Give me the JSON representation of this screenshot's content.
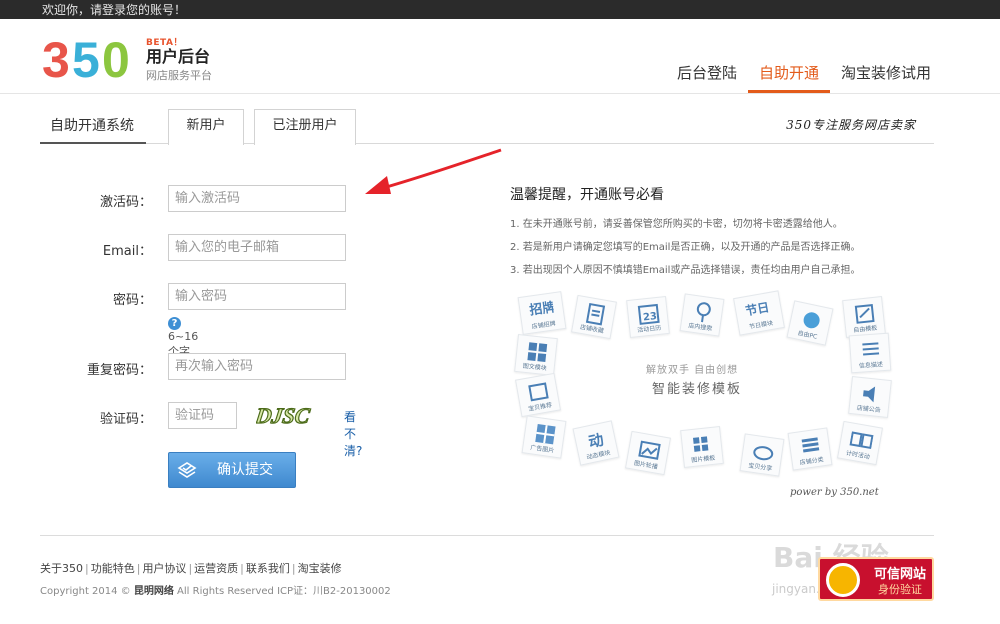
{
  "topbar": {
    "welcome": "欢迎你，请登录您的账号！"
  },
  "header": {
    "logo_text": "350",
    "beta": "BETA！",
    "title": "用户后台",
    "subtitle": "网店服务平台",
    "nav": [
      {
        "label": "后台登陆",
        "active": false
      },
      {
        "label": "自助开通",
        "active": true
      },
      {
        "label": "淘宝装修试用",
        "active": false
      }
    ]
  },
  "tabs": {
    "system_label": "自助开通系统",
    "new_user": "新用户",
    "registered_user": "已注册用户",
    "slogan": "350专注服务网店卖家"
  },
  "form": {
    "activation": {
      "label": "激活码：",
      "placeholder": "输入激活码"
    },
    "email": {
      "label": "Email：",
      "placeholder": "输入您的电子邮箱"
    },
    "password": {
      "label": "密码：",
      "placeholder": "输入密码",
      "hint": "6~16个字符"
    },
    "confirm": {
      "label": "重复密码：",
      "placeholder": "再次输入密码"
    },
    "captcha": {
      "label": "验证码：",
      "placeholder": "验证码",
      "image_text": "DJSC",
      "refresh": "看不清?"
    },
    "submit": "确认提交"
  },
  "tips": {
    "title": "温馨提醒，开通账号必看",
    "items": [
      "1. 在未开通账号前，请妥善保管您所购买的卡密，切勿将卡密透露给他人。",
      "2. 若是新用户请确定您填写的Email是否正确，以及开通的产品是否选择正确。",
      "3. 若出现因个人原因不慎填错Email或产品选择错误，责任均由用户自己承担。"
    ]
  },
  "mosaic": {
    "line1": "解放双手  自由创想",
    "line2": "智能装修模板",
    "powered": "power by 350.net",
    "tiles": [
      "招牌",
      "店铺招牌",
      "店铺收藏",
      "23",
      "活动日历",
      "店内搜索",
      "节日",
      "节日模块",
      "自由PC",
      "自由模板",
      "图文模块",
      "信息描述",
      "店铺公告",
      "宝贝推荐",
      "广告图片",
      "动",
      "动态模块",
      "图片轮播",
      "图片模板",
      "宝贝分享",
      "店铺分类",
      "计时活动",
      "活动模板"
    ]
  },
  "footer": {
    "links": [
      "关于350",
      "功能特色",
      "用户协议",
      "运营资质",
      "联系我们",
      "淘宝装修"
    ],
    "copyright": "Copyright 2014 ©",
    "company": "昆明网络",
    "rights": "All Rights Reserved ICP证：川B2-20130002"
  },
  "watermark": {
    "text": "Bai 经验",
    "url": "jingyan.baidu.com",
    "badge_line1": "可信网站",
    "badge_line2": "身份验证"
  },
  "colors": {
    "accent": "#e35b1b",
    "button": "#4a92d6",
    "logo_red": "#e8554a",
    "logo_blue": "#3ab0d8",
    "logo_green": "#8cc63f"
  }
}
